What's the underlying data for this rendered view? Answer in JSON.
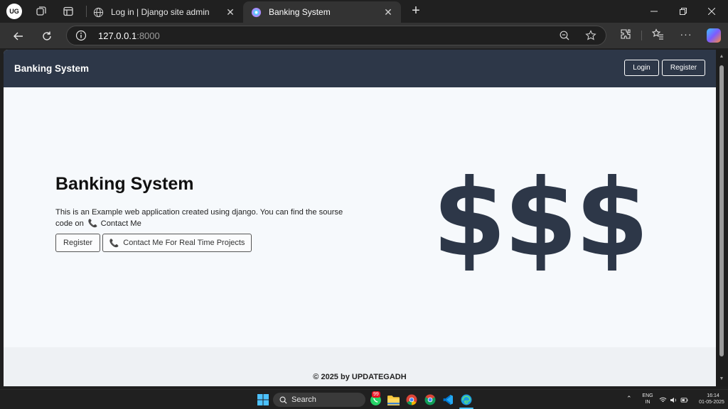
{
  "browser": {
    "profile_initials": "UG",
    "tabs": [
      {
        "title": "Log in | Django site admin"
      },
      {
        "title": "Banking System"
      }
    ],
    "url_host": "127.0.0.1",
    "url_port": ":8000"
  },
  "site": {
    "brand": "Banking System",
    "nav": {
      "login": "Login",
      "register": "Register"
    },
    "hero": {
      "title": "Banking System",
      "desc_text": "This is an Example web application created using django. You can find the sourse code on",
      "contact_link": "Contact Me",
      "register_button": "Register",
      "contact_button": "Contact Me For Real Time Projects",
      "graphic": "$$$"
    },
    "footer": "© 2025 by UPDATEGADH"
  },
  "taskbar": {
    "search_placeholder": "Search",
    "badge_count": "99",
    "lang_top": "ENG",
    "lang_bottom": "IN",
    "time": "16:14",
    "date": "01-05-2025"
  },
  "colors": {
    "navbar_bg": "#2d3748",
    "page_bg": "#f6f9fc",
    "phone_icon": "#d9302c",
    "dollar_color": "#2d3748"
  },
  "icons": [
    "workspaces-icon",
    "tab-actions-icon",
    "globe-icon",
    "back-icon",
    "refresh-icon",
    "info-icon",
    "zoom-out-icon",
    "star-icon",
    "extensions-icon",
    "favorites-icon",
    "more-icon",
    "copilot-icon",
    "phone-icon",
    "windows-start-icon",
    "search-icon",
    "whatsapp-icon",
    "folder-icon",
    "chrome-icon",
    "vscode-icon",
    "edge-icon",
    "wifi-icon",
    "volume-icon",
    "battery-icon"
  ]
}
